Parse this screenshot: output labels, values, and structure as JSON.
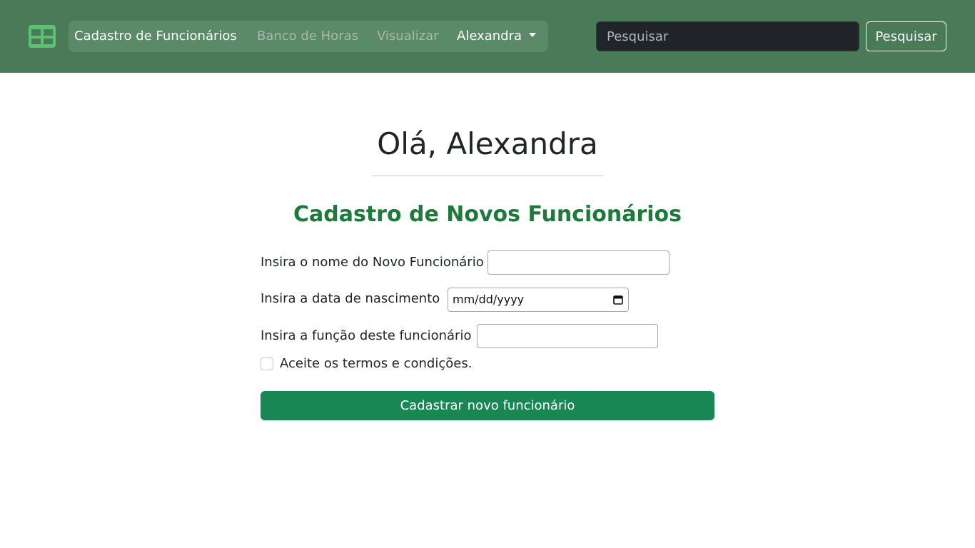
{
  "navbar": {
    "brand_icon": "table-icon",
    "links": {
      "cadastro": "Cadastro de Funcionários",
      "banco": "Banco de Horas",
      "visualizar": "Visualizar",
      "user": "Alexandra"
    },
    "search": {
      "placeholder": "Pesquisar",
      "button_label": "Pesquisar"
    },
    "colors": {
      "background": "#4a7a57",
      "brand_icon": "#5cc075"
    }
  },
  "main": {
    "greeting": "Olá, Alexandra",
    "form_title": "Cadastro de Novos Funcionários",
    "fields": {
      "name_label": "Insira o nome do Novo Funcionário",
      "name_value": "",
      "birthdate_label": "Insira a data de nascimento",
      "birthdate_value": "mm/dd/yyyy",
      "role_label": "Insira a função deste funcionário",
      "role_value": ""
    },
    "terms_label": "Aceite os termos e condições.",
    "terms_checked": false,
    "submit_label": "Cadastrar novo funcionário",
    "colors": {
      "title": "#1e7a3a",
      "button": "#198754"
    }
  }
}
